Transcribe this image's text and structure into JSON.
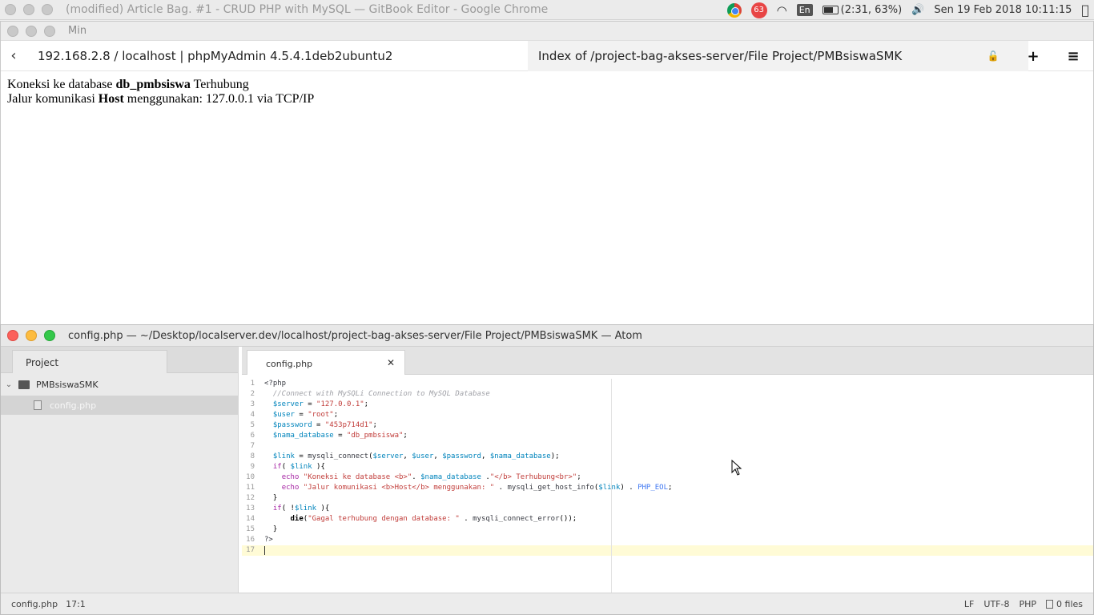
{
  "system_bar": {
    "window_title": "(modified) Article Bag. #1 - CRUD PHP with MySQL — GitBook Editor - Google Chrome",
    "notification_count": "63",
    "language": "En",
    "battery": "(2:31, 63%)",
    "battery_level": 0.63,
    "datetime": "Sen 19 Feb 2018 10:11:15"
  },
  "browser": {
    "window_title": "Min",
    "tab_left": "192.168.2.8 / localhost | phpMyAdmin 4.5.4.1deb2ubuntu2",
    "tab_right": "Index of /project-bag-akses-server/File Project/PMBsiswaSMK",
    "content": {
      "line1_pre": "Koneksi ke database ",
      "line1_bold": "db_pmbsiswa",
      "line1_post": " Terhubung",
      "line2_pre": "Jalur komunikasi ",
      "line2_bold": "Host",
      "line2_post": " menggunakan: 127.0.0.1 via TCP/IP"
    }
  },
  "atom": {
    "window_title": "config.php — ~/Desktop/localserver.dev/localhost/project-bag-akses-server/File Project/PMBsiswaSMK — Atom",
    "tree": {
      "tab_label": "Project",
      "folder": "PMBsiswaSMK",
      "file": "config.php"
    },
    "editor_tab": "config.php",
    "code_lines": [
      "<?php",
      "  //Connect with MySQLi Connection to MySQL Database",
      "  $server = \"127.0.0.1\";",
      "  $user = \"root\";",
      "  $password = \"453p714d1\";",
      "  $nama_database = \"db_pmbsiswa\";",
      "",
      "  $link = mysqli_connect($server, $user, $password, $nama_database);",
      "  if( $link ){",
      "    echo \"Koneksi ke database <b>\". $nama_database .\"</b> Terhubung<br>\";",
      "    echo \"Jalur komunikasi <b>Host</b> menggunakan: \" . mysqli_get_host_info($link) . PHP_EOL;",
      "  }",
      "  if( !$link ){",
      "      die(\"Gagal terhubung dengan database: \" . mysqli_connect_error());",
      "  }",
      "?>",
      ""
    ],
    "status": {
      "file": "config.php",
      "cursor": "17:1",
      "line_ending": "LF",
      "encoding": "UTF-8",
      "grammar": "PHP",
      "files": "0 files"
    }
  }
}
